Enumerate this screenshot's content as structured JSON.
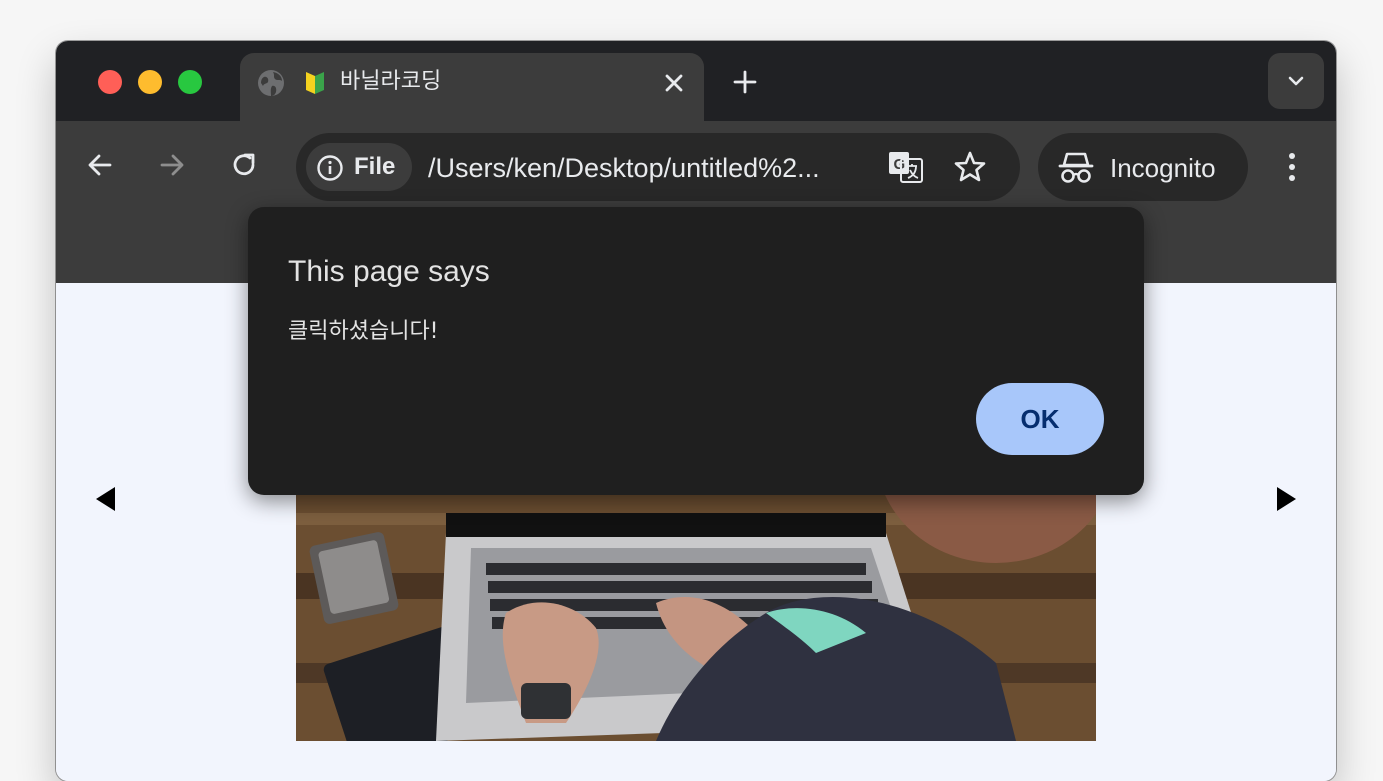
{
  "browser": {
    "tab": {
      "title": "바닐라코딩",
      "favicon": "beginner-leaf-icon"
    },
    "address_bar": {
      "site_chip_label": "File",
      "url": "/Users/ken/Desktop/untitled%2..."
    },
    "profile_label": "Incognito"
  },
  "dialog": {
    "title": "This page says",
    "message": "클릭하셨습니다!",
    "ok_label": "OK"
  },
  "colors": {
    "tab_strip": "#202124",
    "toolbar": "#3c3c3c",
    "dialog_bg": "#1f1f1f",
    "ok_button": "#a8c7fa",
    "ok_text": "#062e6f",
    "page_bg": "#f2f5fd"
  }
}
